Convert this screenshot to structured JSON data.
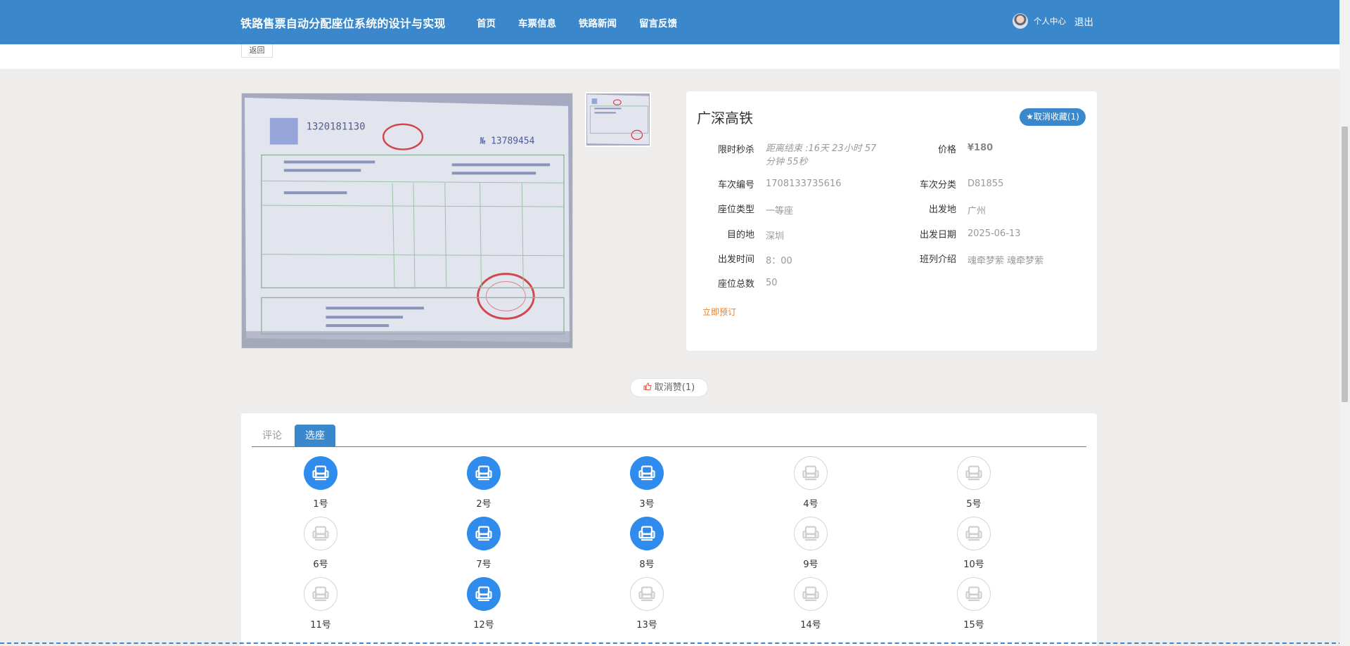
{
  "header": {
    "site_title": "铁路售票自动分配座位系统的设计与实现",
    "nav": [
      "首页",
      "车票信息",
      "铁路新闻",
      "留言反馈"
    ],
    "personal_center": "个人中心",
    "logout": "退出"
  },
  "back_label": "返回",
  "detail": {
    "title": "广深高铁",
    "favorite_label": "★取消收藏(1)",
    "fields": {
      "flash_sale_label": "限时秒杀",
      "flash_sale_value": "距离结束 :16天 23小时 57分钟 55秒",
      "price_label": "价格",
      "price_value": "¥180",
      "train_no_label": "车次编号",
      "train_no_value": "1708133735616",
      "category_label": "车次分类",
      "category_value": "D81855",
      "seat_type_label": "座位类型",
      "seat_type_value": "一等座",
      "departure_label": "出发地",
      "departure_value": "广州",
      "destination_label": "目的地",
      "destination_value": "深圳",
      "date_label": "出发日期",
      "date_value": "2025-06-13",
      "time_label": "出发时间",
      "time_value": "8：00",
      "intro_label": "班列介绍",
      "intro_value": "魂牵梦萦 魂牵梦萦",
      "total_seats_label": "座位总数",
      "total_seats_value": "50"
    },
    "book_now": "立即预订"
  },
  "like_label": "取消赞(1)",
  "tabs": {
    "comment": "评论",
    "seat": "选座"
  },
  "seats": [
    {
      "label": "1号",
      "taken": true
    },
    {
      "label": "2号",
      "taken": true
    },
    {
      "label": "3号",
      "taken": true
    },
    {
      "label": "4号",
      "taken": false
    },
    {
      "label": "5号",
      "taken": false
    },
    {
      "label": "6号",
      "taken": false
    },
    {
      "label": "7号",
      "taken": true
    },
    {
      "label": "8号",
      "taken": true
    },
    {
      "label": "9号",
      "taken": false
    },
    {
      "label": "10号",
      "taken": false
    },
    {
      "label": "11号",
      "taken": false
    },
    {
      "label": "12号",
      "taken": true
    },
    {
      "label": "13号",
      "taken": false
    },
    {
      "label": "14号",
      "taken": false
    },
    {
      "label": "15号",
      "taken": false
    }
  ],
  "colors": {
    "primary": "#3a87cc",
    "seat_taken": "#2f8cec",
    "book_link": "#e8832a"
  }
}
